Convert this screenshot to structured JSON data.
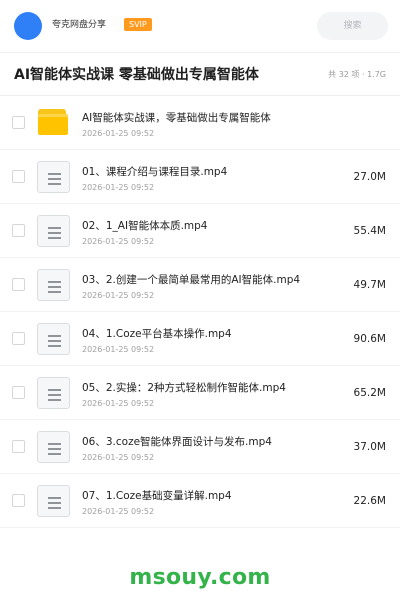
{
  "header": {
    "username": "夸克网盘分享",
    "badge": "SVIP",
    "search_placeholder": "搜索"
  },
  "title": {
    "text": "AI智能体实战课 零基础做出专属智能体",
    "meta": "共 32 项 · 1.7G"
  },
  "files": [
    {
      "name": "AI智能体实战课，零基础做出专属智能体",
      "date": "2026-01-25 09:52",
      "size": "",
      "icon": "folder-icon"
    },
    {
      "name": "01、课程介绍与课程目录.mp4",
      "date": "2026-01-25 09:52",
      "size": "27.0M",
      "icon": "video-file-icon"
    },
    {
      "name": "02、1_AI智能体本质.mp4",
      "date": "2026-01-25 09:52",
      "size": "55.4M",
      "icon": "video-file-icon"
    },
    {
      "name": "03、2.创建一个最简单最常用的AI智能体.mp4",
      "date": "2026-01-25 09:52",
      "size": "49.7M",
      "icon": "video-file-icon"
    },
    {
      "name": "04、1.Coze平台基本操作.mp4",
      "date": "2026-01-25 09:52",
      "size": "90.6M",
      "icon": "video-file-icon"
    },
    {
      "name": "05、2.实操：2种方式轻松制作智能体.mp4",
      "date": "2026-01-25 09:52",
      "size": "65.2M",
      "icon": "video-file-icon"
    },
    {
      "name": "06、3.coze智能体界面设计与发布.mp4",
      "date": "2026-01-25 09:52",
      "size": "37.0M",
      "icon": "video-file-icon"
    },
    {
      "name": "07、1.Coze基础变量详解.mp4",
      "date": "2026-01-25 09:52",
      "size": "22.6M",
      "icon": "video-file-icon"
    }
  ],
  "watermark": "msouy.com",
  "colors": {
    "avatar": "#2f80f6",
    "badge": "#ff9a1f",
    "folder": "#ffc300",
    "watermark": "#33b34a"
  }
}
